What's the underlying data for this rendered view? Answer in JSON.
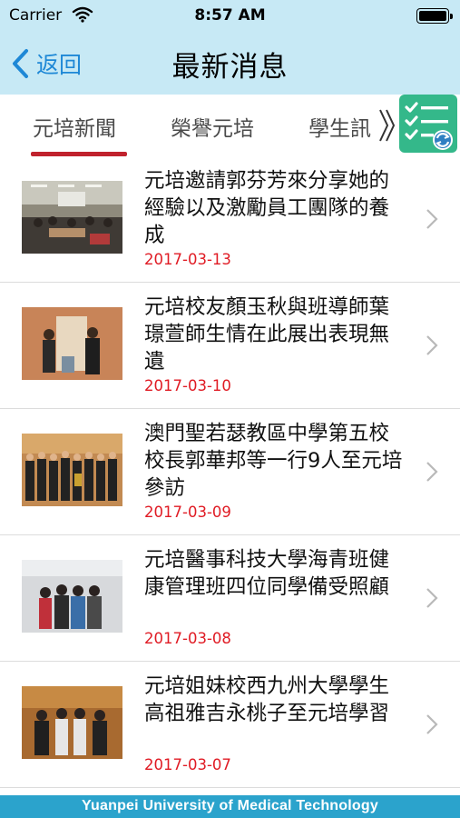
{
  "status_bar": {
    "carrier": "Carrier",
    "time": "8:57 AM"
  },
  "nav": {
    "back_label": "返回",
    "title": "最新消息"
  },
  "tabs": [
    {
      "label": "元培新聞",
      "selected": true
    },
    {
      "label": "榮譽元培",
      "selected": false
    },
    {
      "label": "學生訊",
      "selected": false
    }
  ],
  "tab_action_icon": "checklist-refresh-icon",
  "news": [
    {
      "title": "元培邀請郭芬芳來分享她的經驗以及激勵員工團隊的養成",
      "date": "2017-03-13"
    },
    {
      "title": "元培校友顏玉秋與班導師葉璟萱師生情在此展出表現無遺",
      "date": "2017-03-10"
    },
    {
      "title": "澳門聖若瑟教區中學第五校校長郭華邦等一行9人至元培參訪",
      "date": "2017-03-09"
    },
    {
      "title": "元培醫事科技大學海青班健康管理班四位同學備受照顧",
      "date": "2017-03-08"
    },
    {
      "title": "元培姐妹校西九州大學學生高祖雅吉永桃子至元培學習",
      "date": "2017-03-07"
    }
  ],
  "footer": {
    "text": "Yuanpei University of Medical Technology"
  },
  "colors": {
    "header_bg": "#c7e9f5",
    "accent_blue": "#1e88d6",
    "tab_underline": "#c0222d",
    "date_red": "#e01b24",
    "action_green": "#34b88a",
    "footer_bg": "#2ba3cc"
  }
}
